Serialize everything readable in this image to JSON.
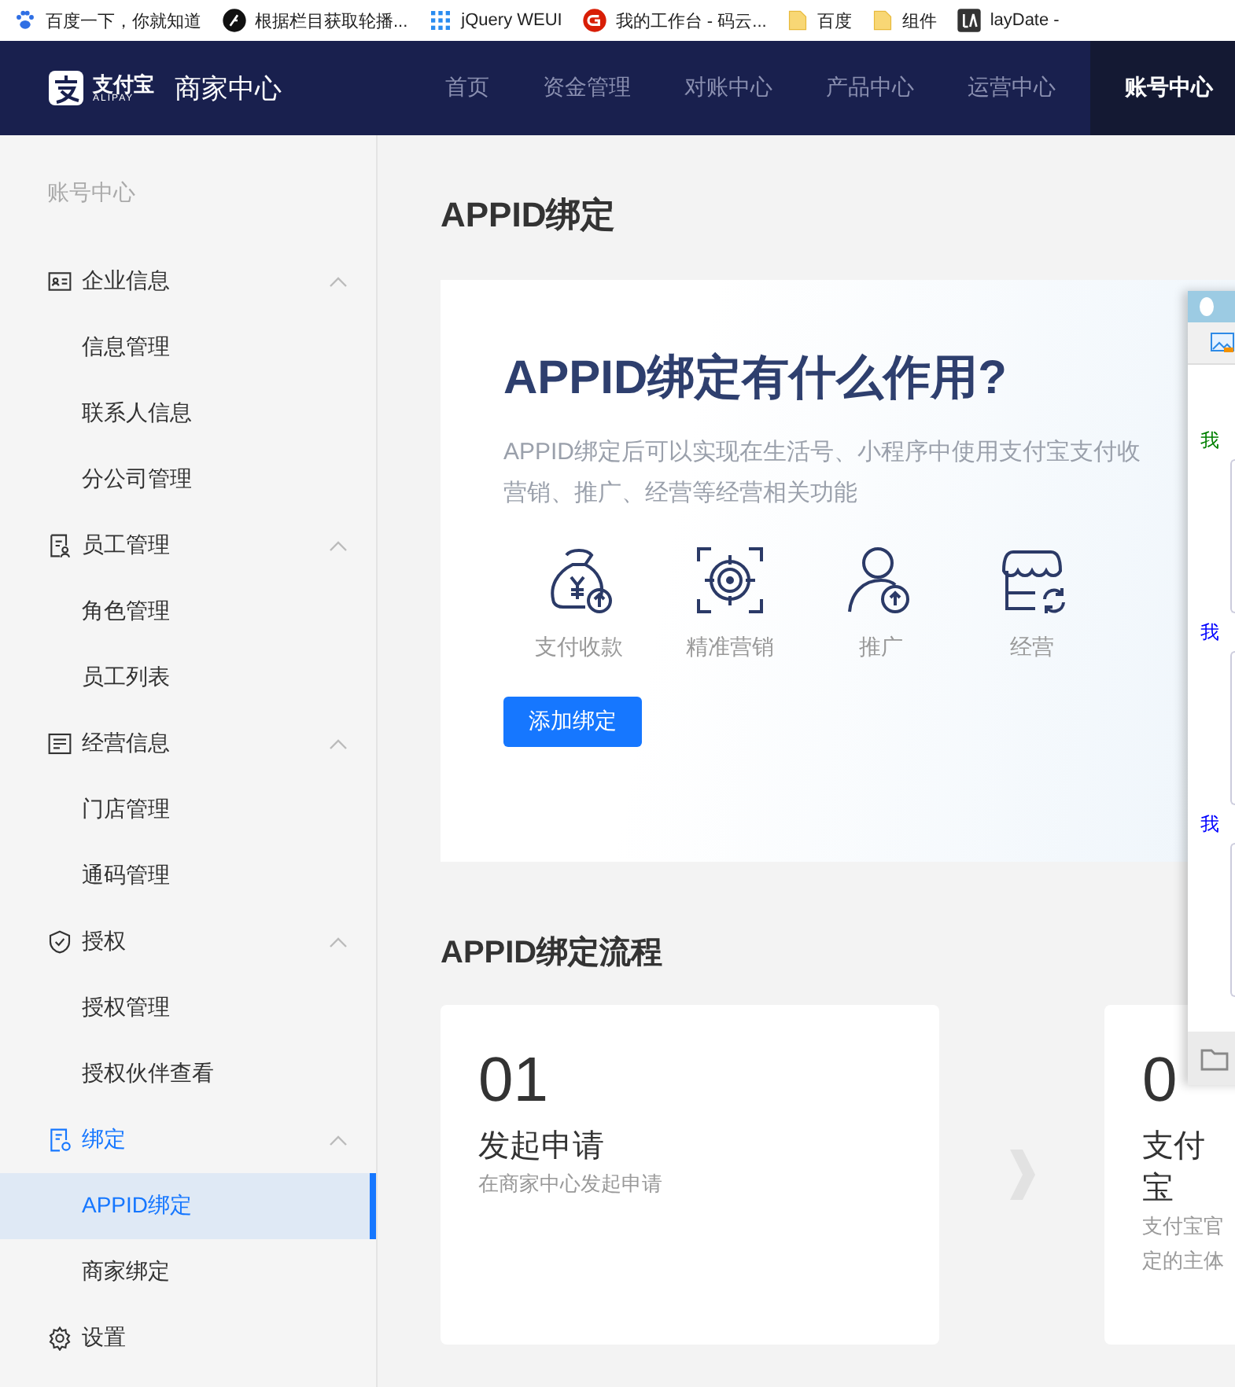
{
  "bookmarks": [
    {
      "label": "百度一下，你就知道"
    },
    {
      "label": "根据栏目获取轮播..."
    },
    {
      "label": "jQuery WEUI"
    },
    {
      "label": "我的工作台 - 码云..."
    },
    {
      "label": "百度"
    },
    {
      "label": "组件"
    },
    {
      "label": "layDate -"
    }
  ],
  "header": {
    "logo": {
      "brand": "支付宝",
      "sub": "ALIPAY"
    },
    "title": "商家中心",
    "nav": [
      {
        "label": "首页",
        "selected": false
      },
      {
        "label": "资金管理",
        "selected": false
      },
      {
        "label": "对账中心",
        "selected": false
      },
      {
        "label": "产品中心",
        "selected": false
      },
      {
        "label": "运营中心",
        "selected": false
      },
      {
        "label": "账号中心",
        "selected": true
      }
    ]
  },
  "sidebar": {
    "heading": "账号中心",
    "items": [
      {
        "label": "企业信息",
        "expanded": true,
        "active": false,
        "children": [
          {
            "label": "信息管理",
            "selected": false
          },
          {
            "label": "联系人信息",
            "selected": false
          },
          {
            "label": "分公司管理",
            "selected": false
          }
        ]
      },
      {
        "label": "员工管理",
        "expanded": true,
        "active": false,
        "children": [
          {
            "label": "角色管理",
            "selected": false
          },
          {
            "label": "员工列表",
            "selected": false
          }
        ]
      },
      {
        "label": "经营信息",
        "expanded": true,
        "active": false,
        "children": [
          {
            "label": "门店管理",
            "selected": false
          },
          {
            "label": "通码管理",
            "selected": false
          }
        ]
      },
      {
        "label": "授权",
        "expanded": true,
        "active": false,
        "children": [
          {
            "label": "授权管理",
            "selected": false
          },
          {
            "label": "授权伙伴查看",
            "selected": false
          }
        ]
      },
      {
        "label": "绑定",
        "expanded": true,
        "active": true,
        "children": [
          {
            "label": "APPID绑定",
            "selected": true
          },
          {
            "label": "商家绑定",
            "selected": false
          }
        ]
      },
      {
        "label": "设置",
        "expanded": false,
        "active": false
      }
    ]
  },
  "main": {
    "page_title": "APPID绑定",
    "intro": {
      "heading": "APPID绑定有什么作用?",
      "description_lines": [
        "APPID绑定后可以实现在生活号、小程序中使用支付宝支付收",
        "营销、推广、经营等经营相关功能"
      ],
      "features": [
        {
          "label": "支付收款"
        },
        {
          "label": "精准营销"
        },
        {
          "label": "推广"
        },
        {
          "label": "经营"
        }
      ],
      "button": "添加绑定"
    },
    "process": {
      "title": "APPID绑定流程",
      "steps": [
        {
          "number": "01",
          "title": "发起申请",
          "description_lines": [
            "在商家中心发起申请"
          ]
        },
        {
          "number": "0",
          "title": "支付宝",
          "description_lines": [
            "支付宝官",
            "定的主体"
          ]
        }
      ]
    }
  },
  "chat_window": {
    "labels": [
      {
        "text": "我",
        "color": "#008000"
      },
      {
        "text": "我",
        "color": "#0000ff"
      },
      {
        "text": "我",
        "color": "#0000ff"
      }
    ]
  }
}
